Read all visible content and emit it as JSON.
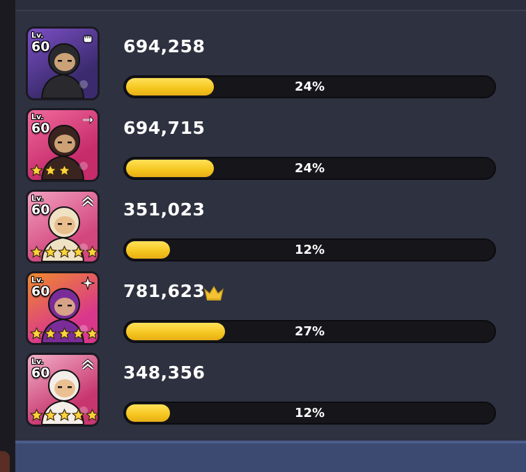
{
  "entries": [
    {
      "level_label": "Lv.",
      "level": "60",
      "score": "694,258",
      "percent": "24%",
      "fraction": 0.24,
      "stars": 0,
      "type_icon": "fist-icon",
      "top_scorer": false,
      "palette": [
        "#7b4fc4",
        "#3b2b6e",
        "#2a2a2e"
      ]
    },
    {
      "level_label": "Lv.",
      "level": "60",
      "score": "694,715",
      "percent": "24%",
      "fraction": 0.24,
      "stars": 3,
      "type_icon": "sword-icon",
      "top_scorer": false,
      "palette": [
        "#f06a9c",
        "#c62b6a",
        "#3a2420"
      ]
    },
    {
      "level_label": "Lv.",
      "level": "60",
      "score": "351,023",
      "percent": "12%",
      "fraction": 0.12,
      "stars": 5,
      "type_icon": "chevron-up-icon",
      "top_scorer": false,
      "palette": [
        "#f3a0c0",
        "#d2477e",
        "#efe2c4"
      ]
    },
    {
      "level_label": "Lv.",
      "level": "60",
      "score": "781,623",
      "percent": "27%",
      "fraction": 0.27,
      "stars": 5,
      "type_icon": "magic-burst-icon",
      "top_scorer": true,
      "palette": [
        "#f08a2c",
        "#d9378c",
        "#7a2c98"
      ]
    },
    {
      "level_label": "Lv.",
      "level": "60",
      "score": "348,356",
      "percent": "12%",
      "fraction": 0.12,
      "stars": 5,
      "type_icon": "chevron-up-icon",
      "top_scorer": false,
      "palette": [
        "#f2b0c8",
        "#c8366f",
        "#f4eee8"
      ]
    }
  ],
  "colors": {
    "panel": "#2e313f",
    "bar_fill": "#f5c51e",
    "bar_track": "#15151a",
    "crown": "#f2c234",
    "star": "#ffd43a"
  }
}
